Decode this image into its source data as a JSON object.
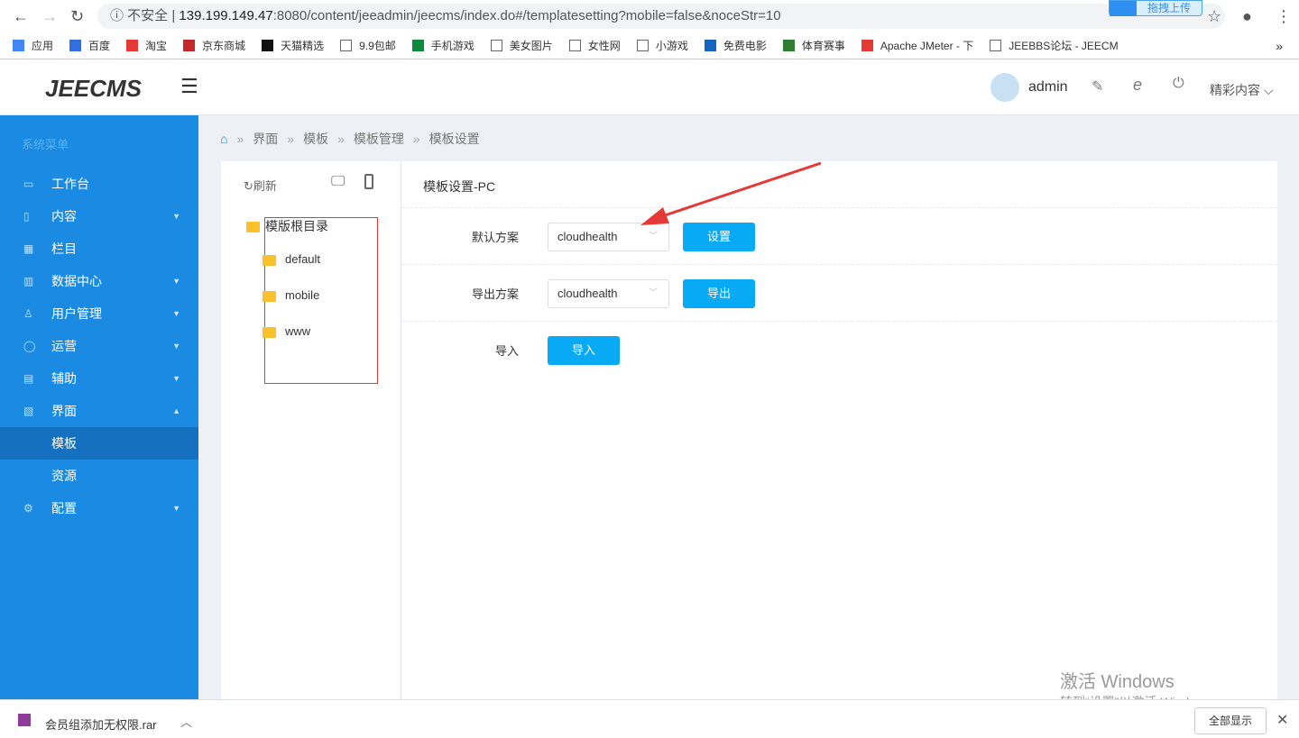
{
  "browser": {
    "url_security": "不安全",
    "url_host": "139.199.149.47",
    "url_rest": ":8080/content/jeeadmin/jeecms/index.do#/templatesetting?mobile=false&noceStr=10",
    "upload_label": "拖拽上传",
    "bookmarks": [
      "应用",
      "百度",
      "淘宝",
      "京东商城",
      "天猫精选",
      "9.9包邮",
      "手机游戏",
      "美女图片",
      "女性网",
      "小游戏",
      "免费电影",
      "体育赛事",
      "Apache JMeter - 下",
      "JEEBBS论坛 - JEECM"
    ]
  },
  "header": {
    "logo": "JEECMS",
    "user": "admin",
    "menu": "精彩内容"
  },
  "sidebar": {
    "title": "系统菜单",
    "items": [
      {
        "label": "工作台",
        "icon": "▭"
      },
      {
        "label": "内容",
        "icon": "▯"
      },
      {
        "label": "栏目",
        "icon": "▦"
      },
      {
        "label": "数据中心",
        "icon": "▥"
      },
      {
        "label": "用户管理",
        "icon": "♙"
      },
      {
        "label": "运营",
        "icon": "◯"
      },
      {
        "label": "辅助",
        "icon": "▤"
      },
      {
        "label": "界面",
        "icon": "▧"
      },
      {
        "label": "模板"
      },
      {
        "label": "资源"
      },
      {
        "label": "配置",
        "icon": "⚙"
      }
    ]
  },
  "breadcrumb": [
    "界面",
    "模板",
    "模板管理",
    "模板设置"
  ],
  "tree": {
    "refresh": "刷新",
    "root": "模版根目录",
    "folders": [
      "default",
      "mobile",
      "www"
    ]
  },
  "panel": {
    "title": "模板设置-PC",
    "rows": [
      {
        "label": "默认方案",
        "value": "cloudhealth",
        "button": "设置"
      },
      {
        "label": "导出方案",
        "value": "cloudhealth",
        "button": "导出"
      },
      {
        "label": "导入",
        "button": "导入"
      }
    ]
  },
  "download": {
    "file": "会员组添加无权限.rar",
    "show_all": "全部显示"
  },
  "watermark": {
    "title": "激活 Windows",
    "sub": "转到“设置”以激活 Windows。"
  }
}
